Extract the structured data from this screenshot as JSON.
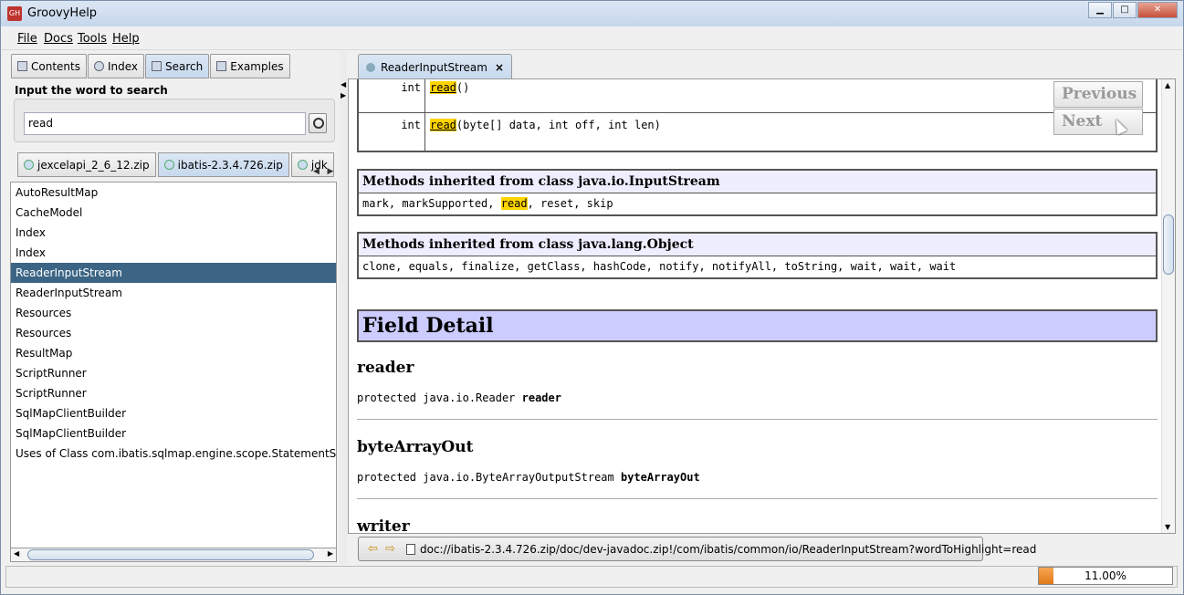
{
  "window": {
    "title": "GroovyHelp",
    "app_icon": "GH"
  },
  "menu": [
    "File",
    "Docs",
    "Tools",
    "Help"
  ],
  "left_tabs": [
    {
      "label": "Contents",
      "icon": "book-icon"
    },
    {
      "label": "Index",
      "icon": "magnifier-icon"
    },
    {
      "label": "Search",
      "icon": "search-doc-icon",
      "selected": true
    },
    {
      "label": "Examples",
      "icon": "examples-icon"
    }
  ],
  "search": {
    "label": "Input the word to search",
    "value": "read"
  },
  "zip_tabs": [
    {
      "label": "jexcelapi_2_6_12.zip"
    },
    {
      "label": "ibatis-2.3.4.726.zip",
      "selected": true
    },
    {
      "label": "jdk"
    }
  ],
  "results": [
    "AutoResultMap",
    "CacheModel",
    "Index",
    "Index",
    "ReaderInputStream",
    "ReaderInputStream",
    "Resources",
    "Resources",
    "ResultMap",
    "ScriptRunner",
    "ScriptRunner",
    "SqlMapClientBuilder",
    "SqlMapClientBuilder",
    "Uses of Class com.ibatis.sqlmap.engine.scope.StatementScope"
  ],
  "selected_result_index": 4,
  "doc_tab": {
    "label": "ReaderInputStream",
    "close": "×"
  },
  "doc": {
    "method_rows": [
      {
        "type": "int",
        "name": "read",
        "args": "()"
      },
      {
        "type": "int",
        "name": "read",
        "args": "(byte[] data, int off, int len)"
      }
    ],
    "inherited": [
      {
        "header": "Methods inherited from class java.io.InputStream",
        "pre": "mark, markSupported, ",
        "hl": "read",
        "post": ", reset, skip"
      },
      {
        "header": "Methods inherited from class java.lang.Object",
        "pre": "clone, equals, finalize, getClass, hashCode, notify, notifyAll, toString, wait, wait, wait",
        "hl": "",
        "post": ""
      }
    ],
    "field_detail": "Field Detail",
    "fields": [
      {
        "name": "reader",
        "sig_pre": "protected java.io.Reader ",
        "sig_name": "reader"
      },
      {
        "name": "byteArrayOut",
        "sig_pre": "protected java.io.ByteArrayOutputStream ",
        "sig_name": "byteArrayOut"
      },
      {
        "name": "writer"
      }
    ],
    "nav": {
      "previous": "Previous",
      "next": "Next"
    }
  },
  "url": "doc://ibatis-2.3.4.726.zip/doc/dev-javadoc.zip!/com/ibatis/common/io/ReaderInputStream?wordToHighlight=read",
  "progress": {
    "value": 0.11,
    "label": "11.00%"
  },
  "colors": {
    "selection": "#3c6585",
    "highlight": "#ffd400",
    "field_detail_bg": "#ccccff",
    "progress": "#e07a1a"
  }
}
